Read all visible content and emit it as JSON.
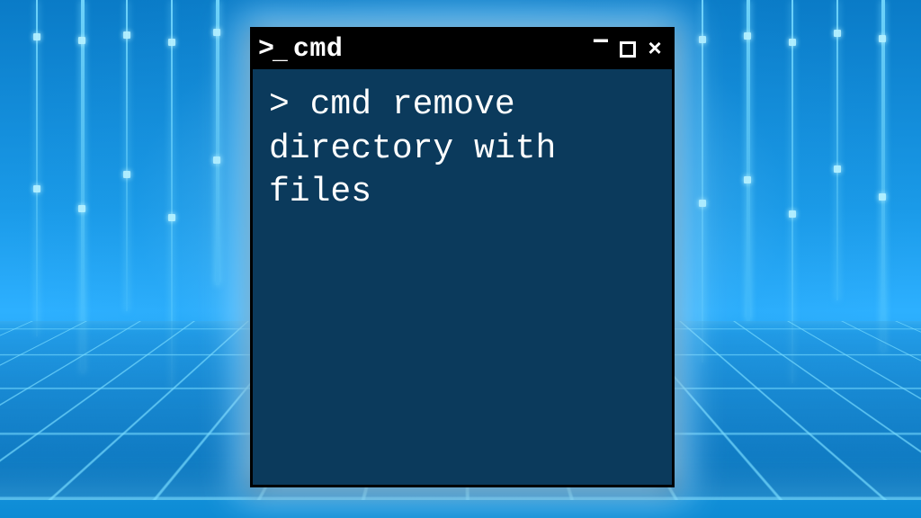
{
  "background": {
    "accent_color": "#1a9ae8",
    "glow_color": "#a0dcff"
  },
  "terminal": {
    "icon_name": "prompt-icon",
    "title": "cmd",
    "controls": {
      "minimize": "−",
      "maximize": "",
      "close": "×"
    },
    "body_bg": "#0b3a5c",
    "prompt_char": ">",
    "command_text": "cmd remove directory with files"
  }
}
